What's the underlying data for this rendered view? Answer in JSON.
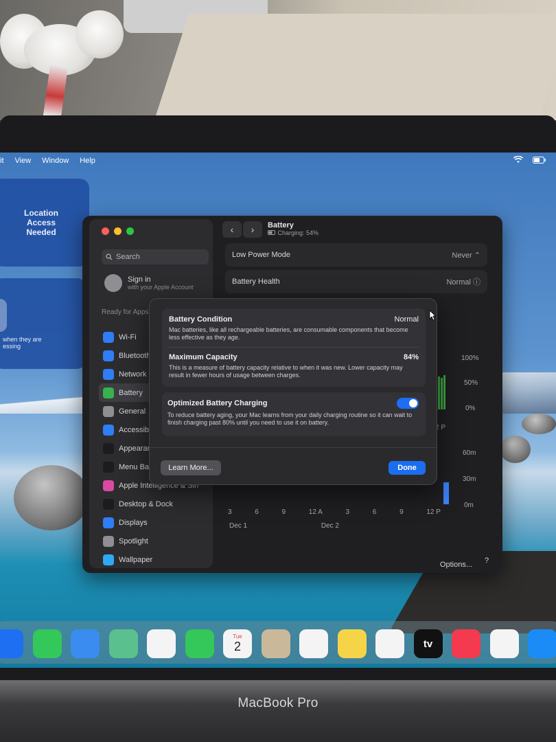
{
  "menubar": {
    "items": [
      "it",
      "View",
      "Window",
      "Help"
    ]
  },
  "widgets": {
    "location": "Location\nAccess\nNeeded",
    "second_line1": "when they are",
    "second_line2": "essing"
  },
  "window": {
    "search_placeholder": "Search",
    "account_title": "Sign in",
    "account_subtitle": "with your Apple Account",
    "ready_text": "Ready for Apps",
    "sidebar_items": [
      {
        "label": "Wi-Fi",
        "color": "#2f7ef6"
      },
      {
        "label": "Bluetooth",
        "color": "#2f7ef6"
      },
      {
        "label": "Network",
        "color": "#2f7ef6"
      },
      {
        "label": "Battery",
        "color": "#37b24d"
      },
      {
        "label": "General",
        "color": "#8e8e93"
      },
      {
        "label": "Accessibility",
        "color": "#2f7ef6"
      },
      {
        "label": "Appearance",
        "color": "#1c1c1e"
      },
      {
        "label": "Menu Bar",
        "color": "#1c1c1e"
      },
      {
        "label": "Apple Intelligence & Siri",
        "color": "#d94aa0"
      },
      {
        "label": "Desktop & Dock",
        "color": "#1c1c1e"
      },
      {
        "label": "Displays",
        "color": "#2f7ef6"
      },
      {
        "label": "Spotlight",
        "color": "#8e8e93"
      },
      {
        "label": "Wallpaper",
        "color": "#2fa8f6"
      }
    ],
    "title": "Battery",
    "subtitle": "Charging: 54%",
    "rows": [
      {
        "label": "Low Power Mode",
        "value": "Never"
      },
      {
        "label": "Battery Health",
        "value": "Normal"
      }
    ],
    "chart": {
      "y_battery": [
        "100%",
        "50%",
        "0%"
      ],
      "y_usage": [
        "60m",
        "30m",
        "0m"
      ],
      "x_ticks": [
        "3",
        "6",
        "9",
        "12 A",
        "3",
        "6",
        "9",
        "12 P"
      ],
      "dates": [
        "Dec 1",
        "Dec 2"
      ],
      "partial_tick": "2 P",
      "partial_text": "s"
    },
    "options_label": "Options...",
    "help_label": "?"
  },
  "sheet": {
    "condition_title": "Battery Condition",
    "condition_value": "Normal",
    "condition_desc": "Mac batteries, like all rechargeable batteries, are consumable components that become less effective as they age.",
    "capacity_title": "Maximum Capacity",
    "capacity_value": "84%",
    "capacity_desc": "This is a measure of battery capacity relative to when it was new. Lower capacity may result in fewer hours of usage between charges.",
    "optimized_title": "Optimized Battery Charging",
    "optimized_desc": "To reduce battery aging, your Mac learns from your daily charging routine so it can wait to finish charging past 80% until you need to use it on battery.",
    "optimized_enabled": true,
    "learn_more": "Learn More...",
    "done": "Done"
  },
  "dock": {
    "calendar_day": "Tue",
    "calendar_date": "2",
    "tv_label": "tv",
    "apps": [
      {
        "icon": "safari-icon",
        "color": "#1e6ff2"
      },
      {
        "icon": "messages-icon",
        "color": "#34c759"
      },
      {
        "icon": "mail-icon",
        "color": "#3a8cf0"
      },
      {
        "icon": "maps-icon",
        "color": "#5ac18e"
      },
      {
        "icon": "photos-icon",
        "color": "#f4f4f4"
      },
      {
        "icon": "facetime-icon",
        "color": "#34c759"
      },
      {
        "icon": "calendar-icon",
        "color": "#f4f4f4"
      },
      {
        "icon": "contacts-icon",
        "color": "#c9b99a"
      },
      {
        "icon": "reminders-icon",
        "color": "#f4f4f4"
      },
      {
        "icon": "notes-icon",
        "color": "#f5d547"
      },
      {
        "icon": "freeform-icon",
        "color": "#f4f4f4"
      },
      {
        "icon": "tv-icon",
        "color": "#111111"
      },
      {
        "icon": "music-icon",
        "color": "#f43a4e"
      },
      {
        "icon": "news-icon",
        "color": "#f4f4f4"
      },
      {
        "icon": "appstore-icon",
        "color": "#1b8cf5"
      }
    ]
  },
  "device": {
    "brand": "MacBook Pro"
  }
}
